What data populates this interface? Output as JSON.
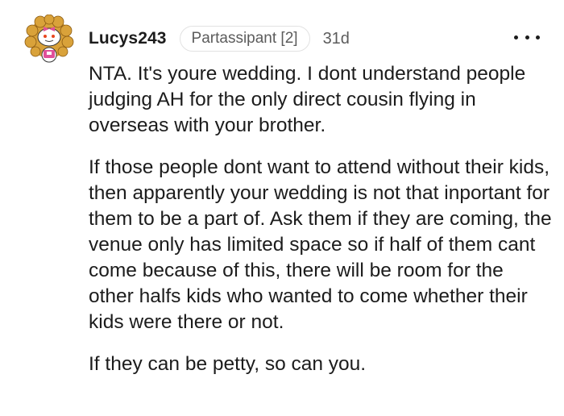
{
  "comment": {
    "username": "Lucys243",
    "flair": "Partassipant [2]",
    "age": "31d",
    "paragraphs": [
      "NTA. It's youre wedding. I dont understand people judging AH for the only direct cousin flying in overseas with your brother.",
      "If those people dont want to attend without their kids, then apparently your wedding is not that inportant for them to be a part of. Ask them if they are coming, the venue only has limited space so if half of them cant come because of this, there will be room for the other halfs kids who wanted to come whether their kids were there or not.",
      "If they can be petty, so can you."
    ]
  },
  "icons": {
    "avatar": "snoo-avatar-icon",
    "more": "more-options-icon"
  },
  "colors": {
    "text": "#1c1c1c",
    "meta": "#5c5c5c",
    "flair_border": "#e2e2e2",
    "avatar_hair": "#d9a23a",
    "avatar_accent": "#e0509a"
  }
}
